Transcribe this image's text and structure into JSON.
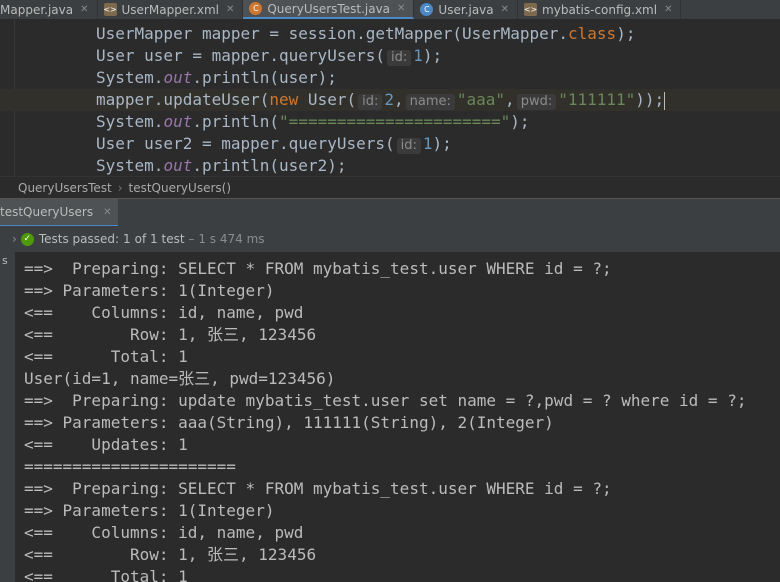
{
  "tabs": [
    {
      "label": "Mapper.java",
      "icon": "java-class-icon"
    },
    {
      "label": "UserMapper.xml",
      "icon": "xml-file-icon"
    },
    {
      "label": "QueryUsersTest.java",
      "icon": "test-class-icon"
    },
    {
      "label": "User.java",
      "icon": "java-class-icon"
    },
    {
      "label": "mybatis-config.xml",
      "icon": "xml-file-icon"
    }
  ],
  "editor": {
    "lines": [
      {
        "a": "UserMapper mapper = session.getMapper(UserMapper.",
        "b": "class",
        "c": ");"
      },
      {
        "a": "User user = mapper.queryUsers(",
        "h1": "id:",
        "n1": "1",
        "c": ");"
      },
      {
        "a": "System.",
        "f": "out",
        "c": ".println(user);"
      },
      {
        "a": "mapper.updateUser(",
        "k": "new",
        "a2": " User(",
        "h1": "id:",
        "n1": "2",
        "p1": ",",
        "h2": "name:",
        "s1": "\"aaa\"",
        "p2": ",",
        "h3": "pwd:",
        "s2": "\"111111\"",
        "c": "));"
      },
      {
        "a": "System.",
        "f": "out",
        "a2": ".println(",
        "s1": "\"======================\"",
        "c": ");"
      },
      {
        "a": "User user2 = mapper.queryUsers(",
        "h1": "id:",
        "n1": "1",
        "c": ");"
      },
      {
        "a": "System.",
        "f": "out",
        "c": ".println(user2);"
      }
    ]
  },
  "breadcrumb": {
    "class": "QueryUsersTest",
    "method": "testQueryUsers()"
  },
  "run_tab": {
    "label": "testQueryUsers"
  },
  "status": {
    "prefix": "Tests passed:",
    "count": "1",
    "suffix": "of 1 test",
    "time": "– 1 s 474 ms"
  },
  "console": {
    "lines": [
      "==>  Preparing: SELECT * FROM mybatis_test.user WHERE id = ?;",
      "==> Parameters: 1(Integer)",
      "<==    Columns: id, name, pwd",
      "<==        Row: 1, 张三, 123456",
      "<==      Total: 1",
      "User(id=1, name=张三, pwd=123456)",
      "==>  Preparing: update mybatis_test.user set name = ?,pwd = ? where id = ?;",
      "==> Parameters: aaa(String), 111111(String), 2(Integer)",
      "<==    Updates: 1",
      "======================",
      "==>  Preparing: SELECT * FROM mybatis_test.user WHERE id = ?;",
      "==> Parameters: 1(Integer)",
      "<==    Columns: id, name, pwd",
      "<==        Row: 1, 张三, 123456",
      "<==      Total: 1"
    ]
  },
  "colors": {
    "accent": "#4a88c7",
    "keyword": "#cc7832",
    "string": "#6a8759",
    "number": "#6897bb",
    "field": "#9876aa",
    "pass": "#4e9a06"
  }
}
